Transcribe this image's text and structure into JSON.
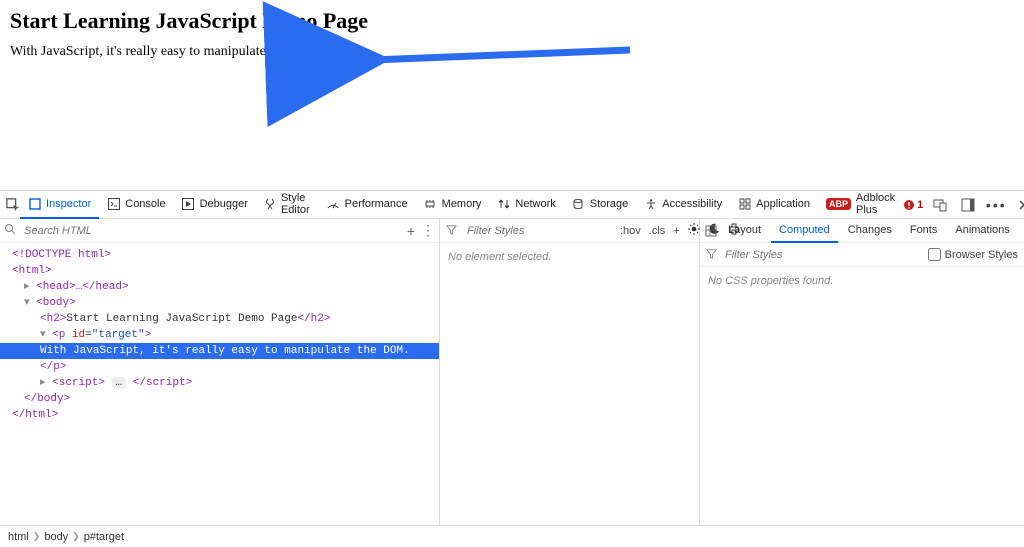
{
  "page": {
    "heading": "Start Learning JavaScript Demo Page",
    "paragraph": "With JavaScript, it's really easy to manipulate the DOM."
  },
  "devtools": {
    "tabs": {
      "inspector": "Inspector",
      "console": "Console",
      "debugger": "Debugger",
      "style_editor": "Style Editor",
      "performance": "Performance",
      "memory": "Memory",
      "network": "Network",
      "storage": "Storage",
      "accessibility": "Accessibility",
      "application": "Application",
      "adblock": "Adblock Plus",
      "abp_badge": "ABP"
    },
    "warn_count": "1",
    "search_placeholder": "Search HTML",
    "tree": {
      "doctype": "<!DOCTYPE html>",
      "html_open": "<html>",
      "head": "<head>…</head>",
      "body_open": "<body>",
      "h2": "<h2>Start Learning JavaScript Demo Page</h2>",
      "p_open": "<p id=\"target\">",
      "p_text": "With JavaScript, it's really easy to manipulate the DOM.",
      "p_close": "</p>",
      "script": "<script> … </script>",
      "body_close": "</body>",
      "html_close": "</html>"
    },
    "rules": {
      "filter_placeholder": "Filter Styles",
      "hov": ":hov",
      "cls": ".cls",
      "no_element": "No element selected."
    },
    "right": {
      "tabs": {
        "layout": "Layout",
        "computed": "Computed",
        "changes": "Changes",
        "fonts": "Fonts",
        "animations": "Animations"
      },
      "filter_placeholder": "Filter Styles",
      "browser_styles": "Browser Styles",
      "no_css": "No CSS properties found."
    },
    "breadcrumb": {
      "b1": "html",
      "b2": "body",
      "b3": "p#target"
    }
  }
}
